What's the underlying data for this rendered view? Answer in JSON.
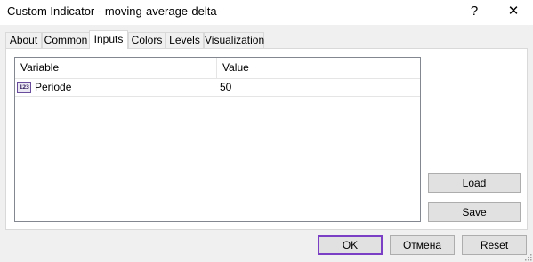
{
  "window": {
    "title": "Custom Indicator - moving-average-delta",
    "help_glyph": "?",
    "close_glyph": "✕"
  },
  "tabs": [
    {
      "label": "About",
      "active": false
    },
    {
      "label": "Common",
      "active": false
    },
    {
      "label": "Inputs",
      "active": true
    },
    {
      "label": "Colors",
      "active": false
    },
    {
      "label": "Levels",
      "active": false
    },
    {
      "label": "Visualization",
      "active": false
    }
  ],
  "inputs_table": {
    "headers": {
      "variable": "Variable",
      "value": "Value"
    },
    "rows": [
      {
        "icon": "integer-type-icon",
        "icon_text": "123",
        "variable": "Periode",
        "value": "50"
      }
    ]
  },
  "side_buttons": {
    "load": "Load",
    "save": "Save"
  },
  "footer": {
    "ok": "OK",
    "cancel": "Отмена",
    "reset": "Reset"
  },
  "colors": {
    "default_button_border": "#7a3fc5",
    "button_face": "#e1e1e1",
    "dialog_background": "#f0f0f0"
  }
}
